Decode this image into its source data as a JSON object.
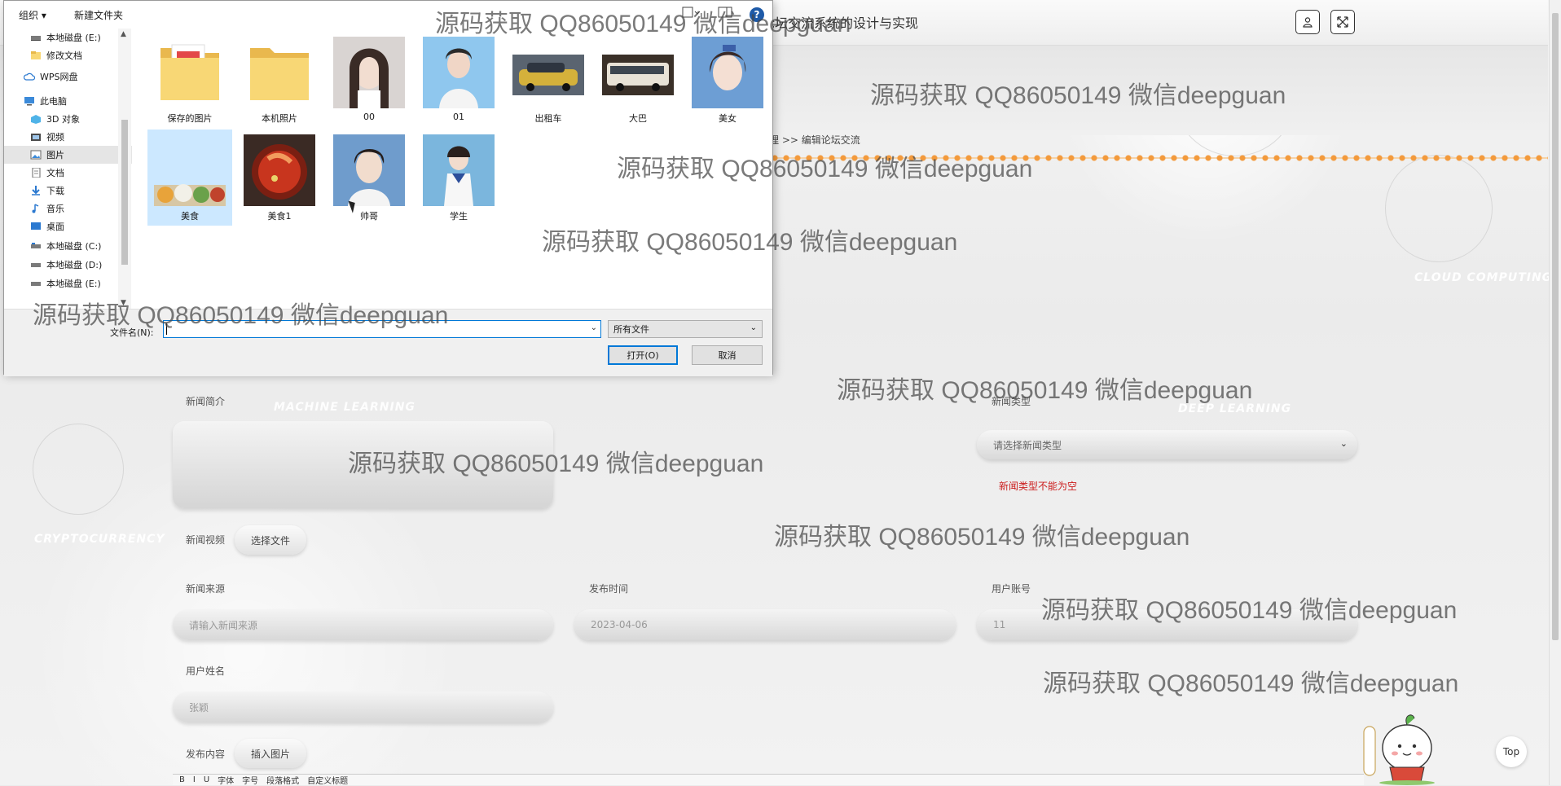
{
  "page": {
    "title": "论坛交流系统的设计与实现",
    "breadcrumb": "理 >> 编辑论坛交流",
    "deco_texts": [
      "CLOUD COMPUTING",
      "MACHINE LEARNING",
      "DEEP LEARNING",
      "CRYPTOCURRENCY"
    ],
    "form": {
      "summary_label": "新闻简介",
      "type_label": "新闻类型",
      "type_placeholder": "请选择新闻类型",
      "type_error": "新闻类型不能为空",
      "video_label": "新闻视频",
      "choose_file": "选择文件",
      "source_label": "新闻来源",
      "source_placeholder": "请输入新闻来源",
      "publish_time_label": "发布时间",
      "publish_time_value": "2023-04-06",
      "account_label": "用户账号",
      "account_value": "11",
      "name_label": "用户姓名",
      "name_value": "张颖",
      "content_label": "发布内容",
      "insert_image": "插入图片"
    },
    "editor_toolbar": [
      "B",
      "I",
      "U",
      "字体",
      "字号",
      "段落格式",
      "自定义标题"
    ],
    "top_button": "Top"
  },
  "dialog": {
    "toolbar": {
      "organize": "组织 ▾",
      "new_folder": "新建文件夹"
    },
    "nav_items": [
      {
        "label": "本地磁盘 (E:)",
        "icon": "drive-icon"
      },
      {
        "label": "修改文档",
        "icon": "folder-icon"
      },
      {
        "label": "WPS网盘",
        "icon": "cloud-icon"
      },
      {
        "label": "此电脑",
        "icon": "computer-icon"
      },
      {
        "label": "3D 对象",
        "icon": "3d-objects-icon"
      },
      {
        "label": "视频",
        "icon": "video-icon"
      },
      {
        "label": "图片",
        "icon": "pictures-icon",
        "selected": true
      },
      {
        "label": "文档",
        "icon": "document-icon"
      },
      {
        "label": "下载",
        "icon": "download-icon"
      },
      {
        "label": "音乐",
        "icon": "music-icon"
      },
      {
        "label": "桌面",
        "icon": "desktop-icon"
      },
      {
        "label": "本地磁盘 (C:)",
        "icon": "drive-icon"
      },
      {
        "label": "本地磁盘 (D:)",
        "icon": "drive-icon"
      },
      {
        "label": "本地磁盘 (E:)",
        "icon": "drive-icon"
      }
    ],
    "files": [
      {
        "name": "保存的图片",
        "kind": "folder"
      },
      {
        "name": "本机照片",
        "kind": "folder"
      },
      {
        "name": "00",
        "kind": "image"
      },
      {
        "name": "01",
        "kind": "image"
      },
      {
        "name": "出租车",
        "kind": "image"
      },
      {
        "name": "大巴",
        "kind": "image"
      },
      {
        "name": "美女",
        "kind": "image"
      },
      {
        "name": "美食",
        "kind": "image",
        "selected": true
      },
      {
        "name": "美食1",
        "kind": "image"
      },
      {
        "name": "帅哥",
        "kind": "image"
      },
      {
        "name": "学生",
        "kind": "image"
      }
    ],
    "filename_label": "文件名(N):",
    "filename_value": "",
    "file_type": "所有文件",
    "open_label": "打开(O)",
    "cancel_label": "取消"
  },
  "watermark": "源码获取 QQ86050149 微信deepguan"
}
